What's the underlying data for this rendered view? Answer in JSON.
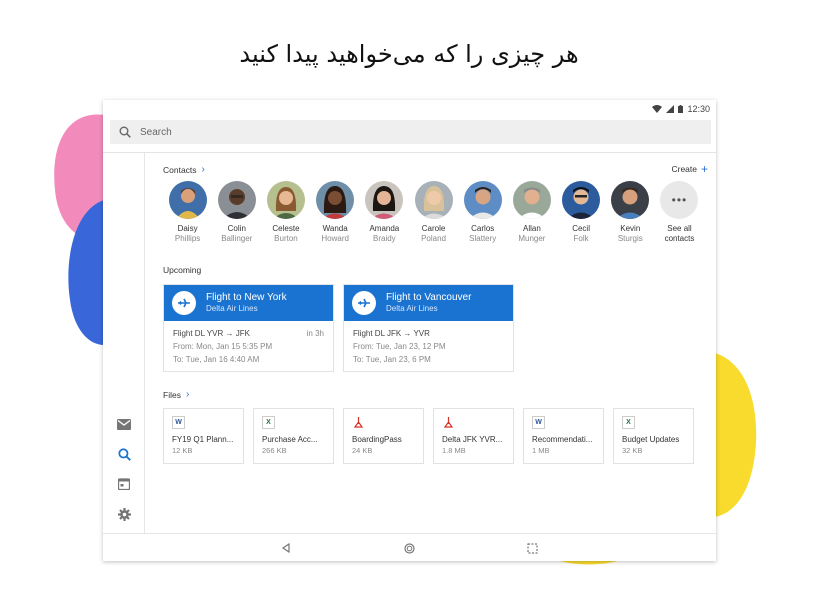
{
  "heading": "هر چیزی را که می‌خواهید پیدا کنید",
  "colors": {
    "accent": "#1a73d1",
    "pink_blob": "#f28bbb",
    "blue_blob": "#3967d9",
    "yellow_blob": "#f9db2d"
  },
  "status_bar": {
    "time": "12:30",
    "icons": [
      "wifi-icon",
      "signal-icon",
      "battery-icon"
    ]
  },
  "search": {
    "placeholder": "Search"
  },
  "contacts": {
    "title": "Contacts",
    "create_label": "Create",
    "people": [
      {
        "first": "Daisy",
        "last": "Phillips"
      },
      {
        "first": "Colin",
        "last": "Ballinger"
      },
      {
        "first": "Celeste",
        "last": "Burton"
      },
      {
        "first": "Wanda",
        "last": "Howard"
      },
      {
        "first": "Amanda",
        "last": "Braidy"
      },
      {
        "first": "Carole",
        "last": "Poland"
      },
      {
        "first": "Carlos",
        "last": "Slattery"
      },
      {
        "first": "Allan",
        "last": "Munger"
      },
      {
        "first": "Cecil",
        "last": "Folk"
      },
      {
        "first": "Kevin",
        "last": "Sturgis"
      }
    ],
    "see_all": {
      "line1": "See all",
      "line2": "contacts"
    }
  },
  "upcoming": {
    "title": "Upcoming",
    "trips": [
      {
        "title": "Flight to New York",
        "airline": "Delta Air Lines",
        "route": "Flight DL YVR → JFK",
        "eta": "in 3h",
        "from": "From: Mon, Jan 15 5:35 PM",
        "to": "To: Tue, Jan 16 4:40 AM"
      },
      {
        "title": "Flight to Vancouver",
        "airline": "Delta Air Lines",
        "route": "Flight DL JFK → YVR",
        "eta": "",
        "from": "From: Tue, Jan 23, 12 PM",
        "to": "To: Tue, Jan 23, 6 PM"
      }
    ]
  },
  "files": {
    "title": "Files",
    "items": [
      {
        "type": "W",
        "type_color": "#2b579a",
        "name": "FY19 Q1 Plann...",
        "size": "12 KB"
      },
      {
        "type": "X",
        "type_color": "#217346",
        "name": "Purchase Acc...",
        "size": "266 KB"
      },
      {
        "type": "pdf",
        "type_color": "#d93025",
        "name": "BoardingPass",
        "size": "24 KB"
      },
      {
        "type": "pdf",
        "type_color": "#d93025",
        "name": "Delta JFK YVR...",
        "size": "1.8 MB"
      },
      {
        "type": "W",
        "type_color": "#2b579a",
        "name": "Recommendati...",
        "size": "1 MB"
      },
      {
        "type": "X",
        "type_color": "#217346",
        "name": "Budget Updates",
        "size": "32 KB"
      }
    ]
  },
  "rail": [
    "mail-icon",
    "search-icon",
    "calendar-icon",
    "settings-icon"
  ],
  "nav": [
    "back-icon",
    "home-icon",
    "recents-icon"
  ]
}
